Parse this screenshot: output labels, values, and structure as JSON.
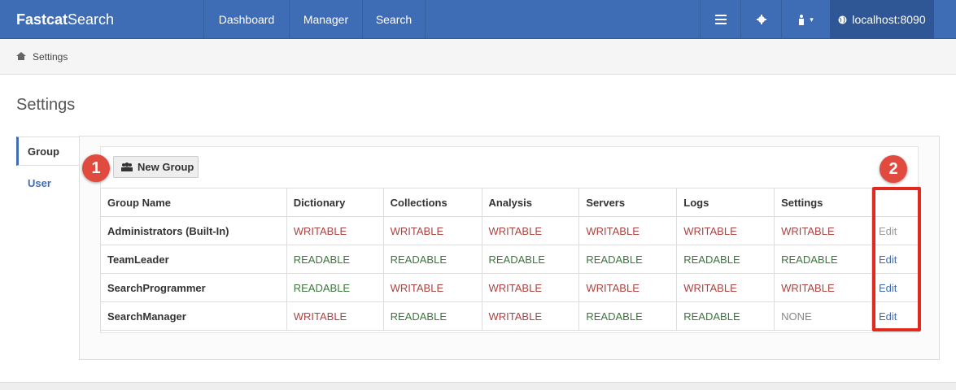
{
  "navbar": {
    "brand_bold": "Fastcat",
    "brand_rest": "Search",
    "links": [
      "Dashboard",
      "Manager",
      "Search"
    ],
    "server": "localhost:8090",
    "icons": [
      "list-icon",
      "gear-icon",
      "user-icon"
    ]
  },
  "breadcrumb": {
    "label": "Settings"
  },
  "page": {
    "title": "Settings"
  },
  "sidebar": {
    "tabs": [
      "Group",
      "User"
    ],
    "active": "Group"
  },
  "toolbar": {
    "new_group_label": "New Group"
  },
  "table": {
    "headers": [
      "Group Name",
      "Dictionary",
      "Collections",
      "Analysis",
      "Servers",
      "Logs",
      "Settings",
      ""
    ],
    "rows": [
      {
        "name": "Administrators (Built-In)",
        "perms": [
          "WRITABLE",
          "WRITABLE",
          "WRITABLE",
          "WRITABLE",
          "WRITABLE",
          "WRITABLE"
        ],
        "edit": "Edit",
        "edit_enabled": false
      },
      {
        "name": "TeamLeader",
        "perms": [
          "READABLE",
          "READABLE",
          "READABLE",
          "READABLE",
          "READABLE",
          "READABLE"
        ],
        "edit": "Edit",
        "edit_enabled": true
      },
      {
        "name": "SearchProgrammer",
        "perms": [
          "READABLE",
          "WRITABLE",
          "WRITABLE",
          "WRITABLE",
          "WRITABLE",
          "WRITABLE"
        ],
        "edit": "Edit",
        "edit_enabled": true
      },
      {
        "name": "SearchManager",
        "perms": [
          "WRITABLE",
          "READABLE",
          "WRITABLE",
          "READABLE",
          "READABLE",
          "NONE"
        ],
        "edit": "Edit",
        "edit_enabled": true
      }
    ]
  },
  "callouts": [
    "1",
    "2"
  ],
  "colors": {
    "navbar": "#3f6db5",
    "writable": "#a94442",
    "readable": "#3c763d",
    "none": "#888888",
    "callout": "#e04a3f"
  }
}
